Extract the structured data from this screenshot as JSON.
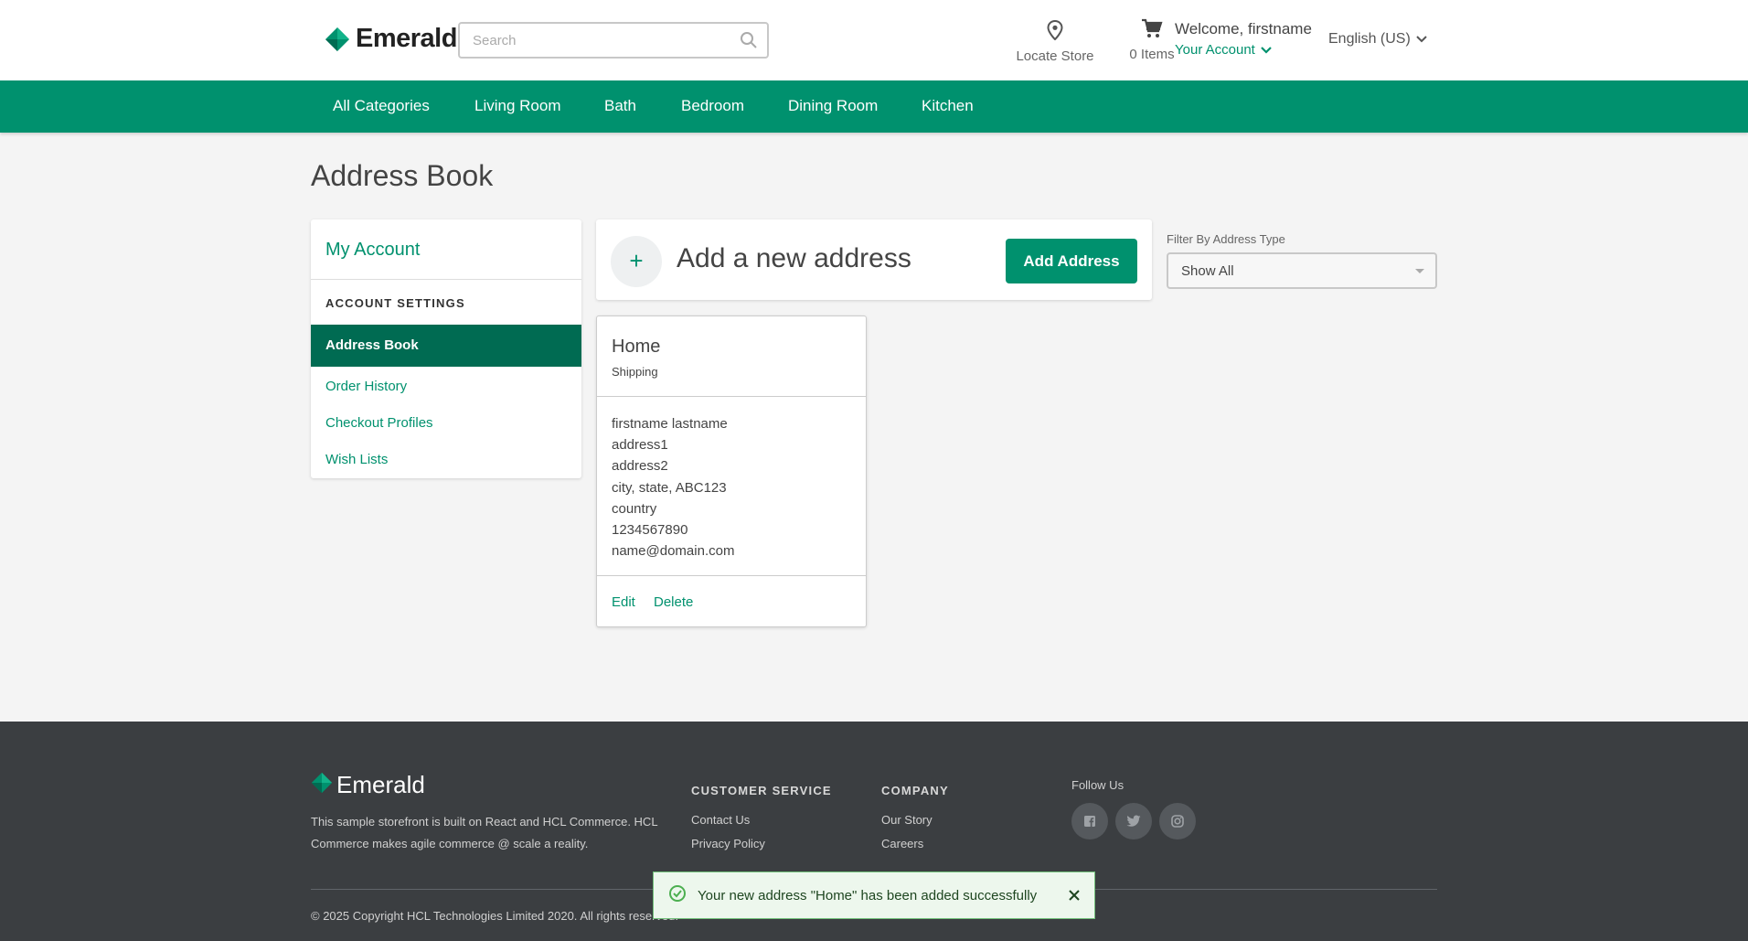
{
  "header": {
    "brand": "Emerald",
    "search_placeholder": "Search",
    "locate_store": "Locate Store",
    "cart_count": "0 Items",
    "welcome": "Welcome, firstname",
    "your_account": "Your Account",
    "language": "English (US)"
  },
  "nav": {
    "items": [
      "All Categories",
      "Living Room",
      "Bath",
      "Bedroom",
      "Dining Room",
      "Kitchen"
    ]
  },
  "page": {
    "title": "Address Book"
  },
  "sidebar": {
    "title": "My Account",
    "section": "ACCOUNT SETTINGS",
    "active": "Address Book",
    "links": [
      "Order History",
      "Checkout Profiles",
      "Wish Lists"
    ]
  },
  "add_address": {
    "plus": "+",
    "text": "Add a new address",
    "button": "Add Address"
  },
  "filter": {
    "label": "Filter By Address Type",
    "selected": "Show All"
  },
  "address_card": {
    "nickname": "Home",
    "type": "Shipping",
    "lines": [
      "firstname lastname",
      "address1",
      "address2",
      "city, state, ABC123",
      "country",
      "1234567890",
      "name@domain.com"
    ],
    "edit": "Edit",
    "delete": "Delete"
  },
  "footer": {
    "brand": "Emerald",
    "description": "This sample storefront is built on React and HCL Commerce. HCL Commerce makes agile commerce @ scale a reality.",
    "customer_service": {
      "heading": "CUSTOMER SERVICE",
      "links": [
        "Contact Us",
        "Privacy Policy"
      ]
    },
    "company": {
      "heading": "COMPANY",
      "links": [
        "Our Story",
        "Careers"
      ]
    },
    "follow_us": "Follow Us",
    "social_icons": [
      "facebook-icon",
      "twitter-icon",
      "instagram-icon"
    ],
    "copyright": "© 2025 Copyright HCL Technologies Limited 2020. All rights reserved."
  },
  "toast": {
    "message": "Your new address \"Home\" has been added successfully"
  },
  "colors": {
    "brand_green": "#00916e",
    "dark_green": "#006b52",
    "footer_bg": "#3b3e41"
  }
}
